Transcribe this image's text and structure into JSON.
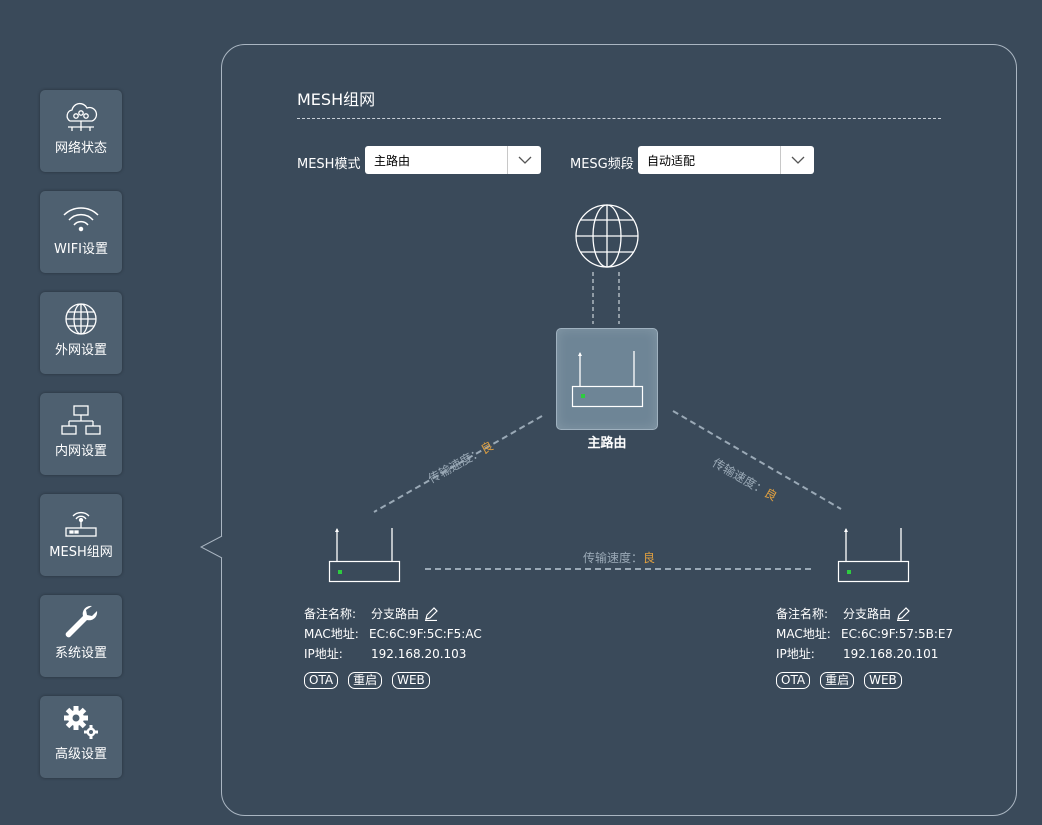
{
  "nav": [
    {
      "label": "网络状态",
      "icon": "cloud-network-icon"
    },
    {
      "label": "WIFI设置",
      "icon": "wifi-icon"
    },
    {
      "label": "外网设置",
      "icon": "globe-icon"
    },
    {
      "label": "内网设置",
      "icon": "lan-topology-icon"
    },
    {
      "label": "MESH组网",
      "icon": "router-antenna-icon",
      "active": true
    },
    {
      "label": "系统设置",
      "icon": "wrench-icon"
    },
    {
      "label": "高级设置",
      "icon": "gears-icon"
    }
  ],
  "page": {
    "title": "MESH组网"
  },
  "form": {
    "mesh_mode_label": "MESH模式",
    "mesh_mode_value": "主路由",
    "mesg_band_label": "MESG频段",
    "mesg_band_value": "自动适配"
  },
  "topology": {
    "main_label": "主路由",
    "speed_text": "传输速度：",
    "speed_quality": "良",
    "nodes": [
      {
        "name_label": "备注名称:",
        "name": "分支路由",
        "mac_label": "MAC地址:",
        "mac": "EC:6C:9F:5C:F5:AC",
        "ip_label": "IP地址:",
        "ip": "192.168.20.103",
        "buttons": [
          "OTA",
          "重启",
          "WEB"
        ]
      },
      {
        "name_label": "备注名称:",
        "name": "分支路由",
        "mac_label": "MAC地址:",
        "mac": "EC:6C:9F:57:5B:E7",
        "ip_label": "IP地址:",
        "ip": "192.168.20.101",
        "buttons": [
          "OTA",
          "重启",
          "WEB"
        ]
      }
    ]
  },
  "colors": {
    "background": "#3a4a5a",
    "nav_tile": "#4e6070",
    "speed_good": "#e0a040",
    "led": "#2ecc40"
  }
}
